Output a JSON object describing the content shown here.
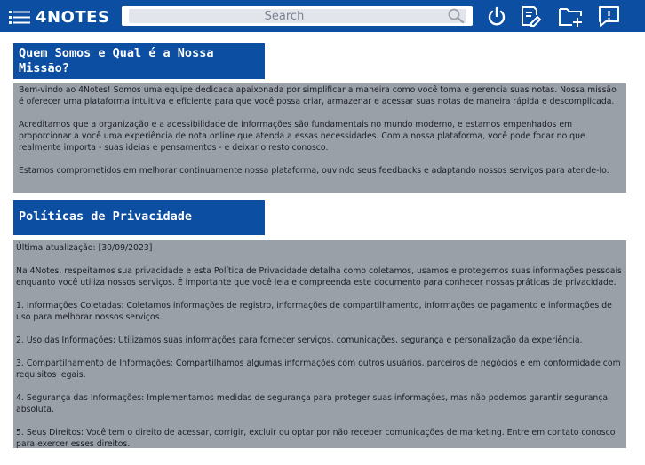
{
  "header": {
    "logo_text": "4NOTES",
    "search_placeholder": "Search",
    "icons": [
      "menu-icon",
      "search-icon",
      "power-icon",
      "notes-icon",
      "new-folder-icon",
      "feedback-icon"
    ]
  },
  "colors": {
    "primary": "#0b4ea2",
    "panel_bg": "#9aa0a8",
    "page_bg": "#ffffff"
  },
  "about": {
    "title": "Quem Somos e Qual é a Nossa Missão?",
    "paragraphs": [
      "Bem-vindo ao 4Notes! Somos uma equipe dedicada apaixonada por simplificar a maneira como você toma e gerencia suas notas. Nossa missão é oferecer uma plataforma intuitiva e eficiente para que você possa criar, armazenar e acessar suas notas de maneira rápida e descomplicada.",
      "Acreditamos que a organização e a acessibilidade de informações são fundamentais no mundo moderno, e estamos empenhados em proporcionar a você uma experiência de nota online que atenda a essas necessidades. Com a nossa plataforma, você pode focar no que realmente importa - suas ideias e pensamentos - e deixar o resto conosco.",
      "Estamos comprometidos em melhorar continuamente nossa plataforma, ouvindo seus feedbacks e adaptando nossos serviços para atende-lo."
    ]
  },
  "privacy": {
    "title": "Políticas de Privacidade",
    "paragraphs": [
      "Última atualização: [30/09/2023]",
      "Na 4Notes, respeitamos sua privacidade e esta Política de Privacidade detalha como coletamos, usamos e protegemos suas informações pessoais enquanto você utiliza nossos serviços. É importante que você leia e compreenda este documento para conhecer nossas práticas de privacidade.",
      "1. Informações Coletadas: Coletamos informações de registro, informações de compartilhamento, informações de pagamento e informações de uso para melhorar nossos serviços.",
      "2. Uso das Informações: Utilizamos suas informações para fornecer serviços, comunicações, segurança e personalização da experiência.",
      "3. Compartilhamento de Informações: Compartilhamos algumas informações com outros usuários, parceiros de negócios e em conformidade com requisitos legais.",
      "4. Segurança das Informações: Implementamos medidas de segurança para proteger suas informações, mas não podemos garantir segurança absoluta.",
      "5. Seus Direitos: Você tem o direito de acessar, corrigir, excluir ou optar por não receber comunicações de marketing. Entre em contato conosco para exercer esses direitos."
    ]
  }
}
